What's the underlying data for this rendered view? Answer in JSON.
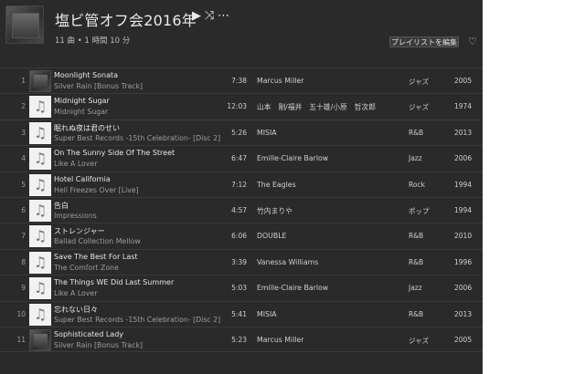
{
  "header": {
    "title": "塩ビ管オフ会2016年",
    "play_icon": "▶",
    "shuffle_icon": "⤨",
    "more_icon": "⋯",
    "meta": "11 曲 • 1 時間 10 分",
    "edit_label": "プレイリストを編集",
    "heart_icon": "♡"
  },
  "tracks": [
    {
      "num": "1",
      "name": "Moonlight Sonata",
      "album": "Silver Rain [Bonus Track]",
      "duration": "7:38",
      "artist": "Marcus Miller",
      "genre": "ジャズ",
      "year": "2005",
      "art": "photo"
    },
    {
      "num": "2",
      "name": "Midnight Sugar",
      "album": "Midnight Sugar",
      "duration": "12:03",
      "artist": "山本　剛/福井　五十雄/小原　哲次郎",
      "genre": "ジャズ",
      "year": "1974",
      "art": "note"
    },
    {
      "num": "3",
      "name": "眠れぬ夜は君のせい",
      "album": "Super Best Records -15th Celebration- [Disc 2]",
      "duration": "5:26",
      "artist": "MISIA",
      "genre": "R&B",
      "year": "2013",
      "art": "note"
    },
    {
      "num": "4",
      "name": "On The Sunny Side Of The Street",
      "album": "Like A Lover",
      "duration": "6:47",
      "artist": "Emille-Claire Barlow",
      "genre": "Jazz",
      "year": "2006",
      "art": "note"
    },
    {
      "num": "5",
      "name": "Hotel California",
      "album": "Hell Freezes Over [Live]",
      "duration": "7:12",
      "artist": "The Eagles",
      "genre": "Rock",
      "year": "1994",
      "art": "note"
    },
    {
      "num": "6",
      "name": "告白",
      "album": "Impressions",
      "duration": "4:57",
      "artist": "竹内まりや",
      "genre": "ポップ",
      "year": "1994",
      "art": "note"
    },
    {
      "num": "7",
      "name": "ストレンジャー",
      "album": "Ballad Collection Mellow",
      "duration": "6:06",
      "artist": "DOUBLE",
      "genre": "R&B",
      "year": "2010",
      "art": "note"
    },
    {
      "num": "8",
      "name": "Save The Best For Last",
      "album": "The Comfort Zone",
      "duration": "3:39",
      "artist": "Vanessa Williams",
      "genre": "R&B",
      "year": "1996",
      "art": "note"
    },
    {
      "num": "9",
      "name": "The Things WE Did Last Summer",
      "album": "Like A Lover",
      "duration": "5:03",
      "artist": "Emille-Claire Barlow",
      "genre": "Jazz",
      "year": "2006",
      "art": "note"
    },
    {
      "num": "10",
      "name": "忘れない日々",
      "album": "Super Best Records -15th Celebration- [Disc 2]",
      "duration": "5:41",
      "artist": "MISIA",
      "genre": "R&B",
      "year": "2013",
      "art": "note"
    },
    {
      "num": "11",
      "name": "Sophisticated Lady",
      "album": "Silver Rain [Bonus Track]",
      "duration": "5:23",
      "artist": "Marcus Miller",
      "genre": "ジャズ",
      "year": "2005",
      "art": "photo"
    }
  ],
  "note_glyph": "♫"
}
